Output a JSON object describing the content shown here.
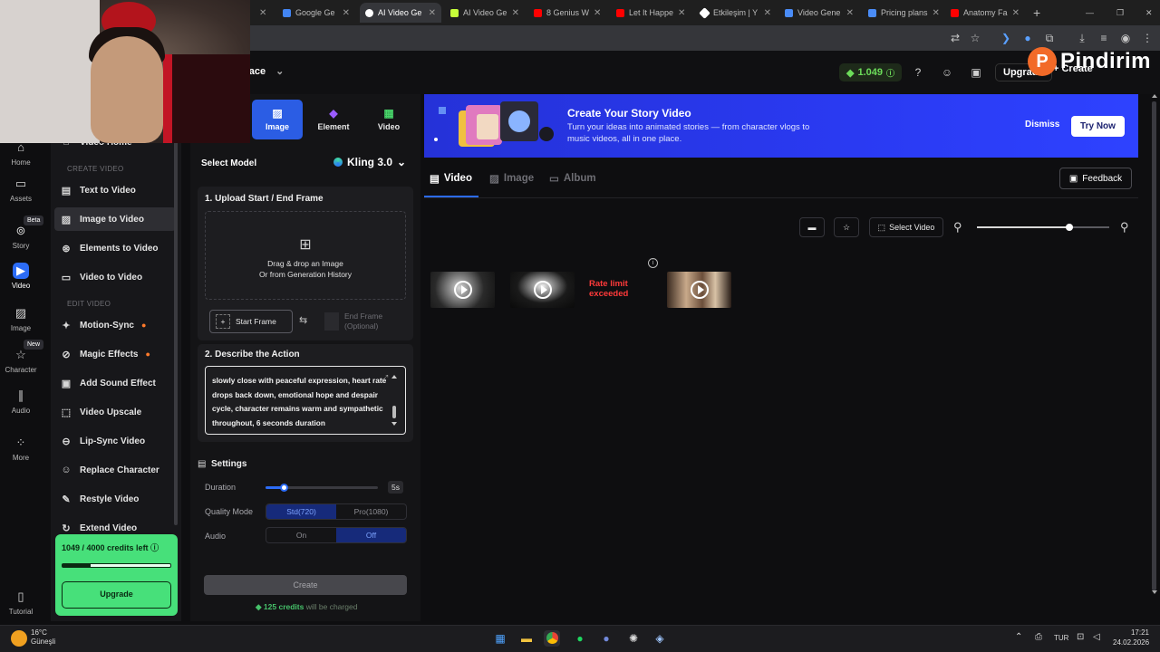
{
  "browser": {
    "tabs": [
      {
        "label": "Google Ge",
        "active": false,
        "color": "#4285f4"
      },
      {
        "label": "AI Video Ge",
        "active": true,
        "color": "#ffffff"
      },
      {
        "label": "AI Video Ge",
        "active": false,
        "color": "#c7ff3a"
      },
      {
        "label": "8 Genius W",
        "active": false,
        "color": "#ff0000"
      },
      {
        "label": "Let It Happe",
        "active": false,
        "color": "#ff0000"
      },
      {
        "label": "Etkileşim | Y",
        "active": false,
        "color": "#ffffff"
      },
      {
        "label": "Video Gene",
        "active": false,
        "color": "#4a8cf7"
      },
      {
        "label": "Pricing plans",
        "active": false,
        "color": "#4a8cf7"
      },
      {
        "label": "Anatomy Fa",
        "active": false,
        "color": "#ff0000"
      }
    ]
  },
  "header": {
    "space_label": "pace",
    "credits": "1.049",
    "upgrade_label": "Upgrade",
    "create_label": "Create"
  },
  "watermark": {
    "letter": "P",
    "text": "Pindirim"
  },
  "rail": {
    "items": [
      {
        "label": "Home",
        "icon": "home-icon"
      },
      {
        "label": "Assets",
        "icon": "folder-icon"
      },
      {
        "label": "Story",
        "icon": "story-icon",
        "badge": "Beta"
      },
      {
        "label": "Video",
        "icon": "video-icon",
        "active": true
      },
      {
        "label": "Image",
        "icon": "image-icon"
      },
      {
        "label": "Character",
        "icon": "star-icon",
        "badge": "New"
      },
      {
        "label": "Audio",
        "icon": "audio-icon"
      },
      {
        "label": "More",
        "icon": "more-icon"
      },
      {
        "label": "Tutorial",
        "icon": "book-icon"
      }
    ]
  },
  "menu": {
    "video_home": "Video Home",
    "section_create": "CREATE VIDEO",
    "create_items": [
      "Text to Video",
      "Image to Video",
      "Elements to Video",
      "Video to Video"
    ],
    "section_edit": "EDIT VIDEO",
    "edit_items": [
      "Motion-Sync",
      "Magic Effects",
      "Add Sound Effect",
      "Video Upscale",
      "Lip-Sync Video",
      "Replace Character",
      "Restyle Video",
      "Extend Video"
    ]
  },
  "credits_box": {
    "text": "1049 / 4000 credits left",
    "fraction": 0.26,
    "upgrade_label": "Upgrade"
  },
  "panel": {
    "tabs": [
      "Image",
      "Element",
      "Video"
    ],
    "select_model_label": "Select Model",
    "model_name": "Kling 3.0",
    "upload_title": "1. Upload Start / End Frame",
    "drop_line1": "Drag & drop an Image",
    "drop_line2": "Or from Generation History",
    "start_frame": "Start Frame",
    "end_frame": "End Frame",
    "end_frame_optional": "(Optional)",
    "describe_title": "2. Describe the Action",
    "prompt_text": "slowly close with peaceful expression, heart rate drops back down, emotional hope and despair cycle, character remains warm and sympathetic throughout, 6 seconds duration",
    "settings_title": "Settings",
    "duration_label": "Duration",
    "duration_value": "5s",
    "duration_fraction": 0.16,
    "quality_label": "Quality Mode",
    "quality_options": [
      "Std(720)",
      "Pro(1080)"
    ],
    "audio_label": "Audio",
    "audio_options": [
      "On",
      "Off"
    ],
    "create_label": "Create",
    "charge_credits": "125 credits",
    "charge_suffix": "will be charged"
  },
  "banner": {
    "title": "Create Your Story Video",
    "subtitle": "Turn your ideas into animated stories — from character vlogs to music videos, all in one place.",
    "dismiss": "Dismiss",
    "try_now": "Try Now"
  },
  "content": {
    "tabs": [
      "Video",
      "Image",
      "Album"
    ],
    "feedback": "Feedback",
    "select_video": "Select Video",
    "zoom_fraction": 0.7,
    "rate_limit_line1": "Rate limit",
    "rate_limit_line2": "exceeded",
    "info_glyph": "i"
  },
  "taskbar": {
    "weather_temp": "16°C",
    "weather_desc": "Güneşli",
    "lang": "TUR",
    "time": "17:21",
    "date": "24.02.2026"
  }
}
